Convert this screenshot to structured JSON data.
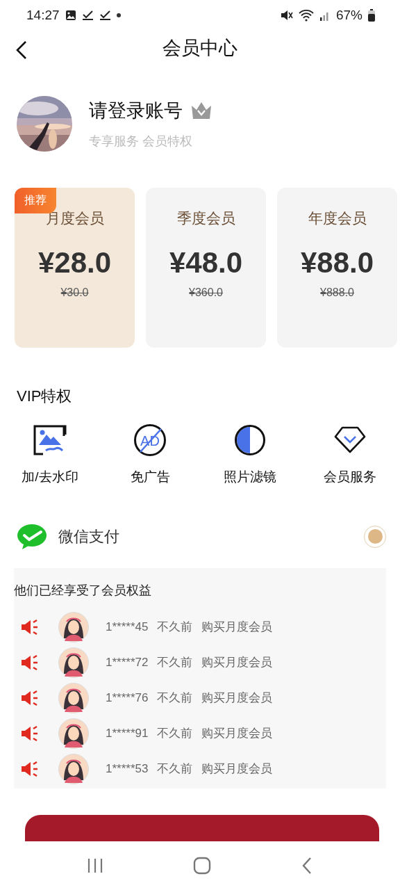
{
  "status_bar": {
    "time": "14:27",
    "battery": "67%"
  },
  "header": {
    "title": "会员中心"
  },
  "profile": {
    "name": "请登录账号",
    "subtitle": "专享服务 会员特权"
  },
  "plans": [
    {
      "name": "月度会员",
      "price": "¥28.0",
      "original_price": "¥30.0",
      "badge": "推荐",
      "selected": true
    },
    {
      "name": "季度会员",
      "price": "¥48.0",
      "original_price": "¥360.0",
      "selected": false
    },
    {
      "name": "年度会员",
      "price": "¥88.0",
      "original_price": "¥888.0",
      "selected": false
    }
  ],
  "perks": {
    "title": "VIP特权",
    "items": [
      {
        "label": "加/去水印",
        "kind": "watermark"
      },
      {
        "label": "免广告",
        "kind": "no-ads",
        "icon_text": "AD"
      },
      {
        "label": "照片滤镜",
        "kind": "filter"
      },
      {
        "label": "会员服务",
        "kind": "diamond"
      }
    ]
  },
  "payment": {
    "label": "微信支付",
    "selected": true
  },
  "buyers": {
    "title": "他们已经享受了会员权益",
    "rows": [
      {
        "user": "1*****45",
        "time": "不久前",
        "action": "购买月度会员"
      },
      {
        "user": "1*****72",
        "time": "不久前",
        "action": "购买月度会员"
      },
      {
        "user": "1*****76",
        "time": "不久前",
        "action": "购买月度会员"
      },
      {
        "user": "1*****91",
        "time": "不久前",
        "action": "购买月度会员"
      },
      {
        "user": "1*****53",
        "time": "不久前",
        "action": "购买月度会员"
      }
    ]
  }
}
